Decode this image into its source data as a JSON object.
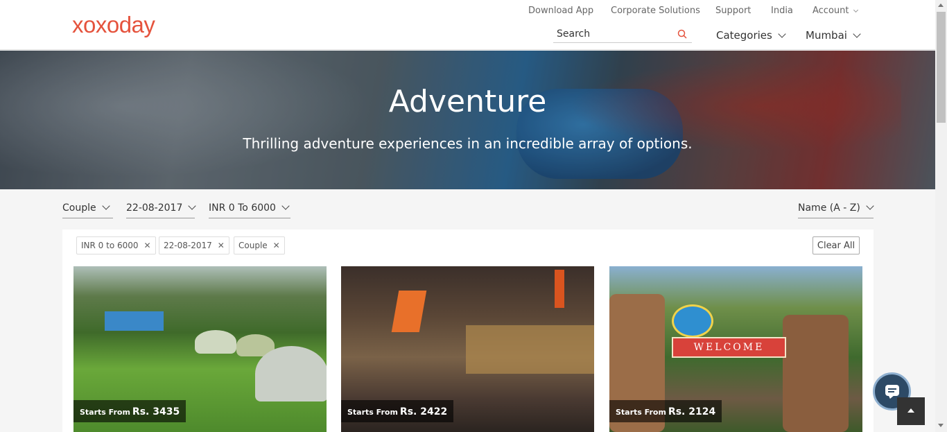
{
  "header": {
    "logo": "xoxoday",
    "links": [
      "Download App",
      "Corporate Solutions",
      "Support",
      "India",
      "Account"
    ],
    "search_placeholder": "Search",
    "categories_label": "Categories",
    "city_label": "Mumbai"
  },
  "hero": {
    "title": "Adventure",
    "subtitle": "Thrilling adventure experiences in an incredible array of options."
  },
  "filters": {
    "group": "Couple",
    "date": "22-08-2017",
    "budget": "INR 0 To 6000",
    "sort": "Name (A - Z)"
  },
  "chips": [
    "INR 0 to 6000",
    "22-08-2017",
    "Couple"
  ],
  "clear_all": "Clear All",
  "cards": [
    {
      "starts_from": "Starts From",
      "price": "Rs. 3435"
    },
    {
      "starts_from": "Starts From",
      "price": "Rs. 2422"
    },
    {
      "starts_from": "Starts From",
      "price": "Rs. 2124"
    }
  ],
  "card3_sign": "WELCOME",
  "colors": {
    "brand": "#e5533d",
    "chat": "#2d4a66"
  },
  "icons": [
    "search-icon",
    "chevron-down-icon",
    "close-icon",
    "chat-icon",
    "arrow-up-icon"
  ]
}
